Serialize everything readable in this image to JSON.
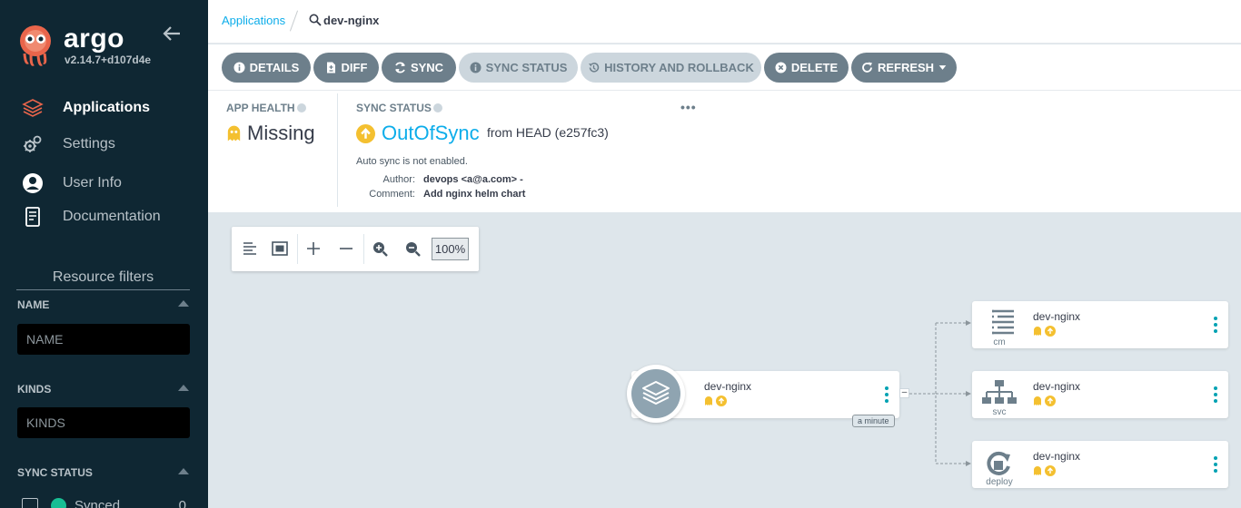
{
  "sidebar": {
    "brand": "argo",
    "version": "v2.14.7+d107d4e",
    "nav": [
      {
        "label": "Applications",
        "icon": "layers-icon",
        "active": true
      },
      {
        "label": "Settings",
        "icon": "gears-icon"
      },
      {
        "label": "User Info",
        "icon": "user-circle-icon"
      },
      {
        "label": "Documentation",
        "icon": "book-icon"
      }
    ],
    "filters_title": "Resource filters",
    "name_filter": {
      "label": "NAME",
      "placeholder": "NAME"
    },
    "kinds_filter": {
      "label": "KINDS",
      "placeholder": "KINDS"
    },
    "sync_status": {
      "label": "SYNC STATUS",
      "first_option": "Synced",
      "first_count": "0"
    }
  },
  "breadcrumb": {
    "link": "Applications",
    "current": "dev-nginx"
  },
  "toolbar": {
    "details": "DETAILS",
    "diff": "DIFF",
    "sync": "SYNC",
    "sync_status": "SYNC STATUS",
    "history": "HISTORY AND ROLLBACK",
    "delete": "DELETE",
    "refresh": "REFRESH"
  },
  "status": {
    "app_health_label": "APP HEALTH",
    "health_value": "Missing",
    "sync_status_label": "SYNC STATUS",
    "sync_value": "OutOfSync",
    "from": "from HEAD (e257fc3)",
    "auto_sync": "Auto sync is not enabled.",
    "author_label": "Author:",
    "author_value": "devops <a@a.com> -",
    "comment_label": "Comment:",
    "comment_value": "Add nginx helm chart",
    "more": "•••"
  },
  "graph": {
    "zoom": "100%",
    "app": {
      "name": "dev-nginx",
      "age": "a minute",
      "collapse": "–"
    },
    "resources": [
      {
        "name": "dev-nginx",
        "kind": "cm"
      },
      {
        "name": "dev-nginx",
        "kind": "svc"
      },
      {
        "name": "dev-nginx",
        "kind": "deploy"
      }
    ]
  },
  "colors": {
    "accent": "#0dadea",
    "warning": "#f4c030",
    "sidebar": "#0f2733",
    "button": "#6d7f8b"
  }
}
